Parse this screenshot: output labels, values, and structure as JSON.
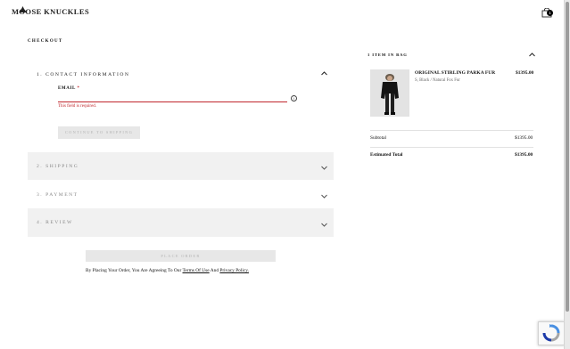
{
  "header": {
    "brand": "MOOSE KNUCKLES",
    "cart_count": "1"
  },
  "checkout": {
    "title": "CHECKOUT",
    "steps": [
      {
        "label": "1.  CONTACT INFORMATION",
        "expanded": true
      },
      {
        "label": "2.  SHIPPING",
        "expanded": false
      },
      {
        "label": "3.  PAYMENT",
        "expanded": false
      },
      {
        "label": "4.  REVIEW",
        "expanded": false
      }
    ],
    "email": {
      "label": "EMAIL",
      "required_mark": "*",
      "value": "",
      "placeholder": "",
      "error": "This field is required.",
      "info_icon_glyph": "i"
    },
    "continue_label": "CONTINUE TO SHIPPING",
    "place_order_label": "PLACE ORDER",
    "legal": {
      "prefix": "By Placing Your Order, You Are Agreeing To Our ",
      "terms": "Terms Of Use",
      "middle": " And ",
      "privacy": "Privacy Policy."
    }
  },
  "bag": {
    "header": "1 ITEM IN BAG",
    "item": {
      "name": "ORIGINAL STIRLING PARKA FUR",
      "variant": "S, Black / Natural Fox Fur",
      "price": "$1395.00"
    },
    "subtotal_label": "Subtotal",
    "subtotal_value": "$1395.00",
    "total_label": "Estimated Total",
    "total_value": "$1395.00"
  },
  "colors": {
    "error": "#c0262c",
    "disabled_button": "#e7e7e7",
    "collapsed_step_bg": "#f1f1f1"
  },
  "icons": {
    "cart": "shopping-bag-icon",
    "chevron_up": "chevron-up-icon",
    "chevron_down": "chevron-down-icon",
    "info": "info-icon",
    "recaptcha": "recaptcha-icon"
  }
}
